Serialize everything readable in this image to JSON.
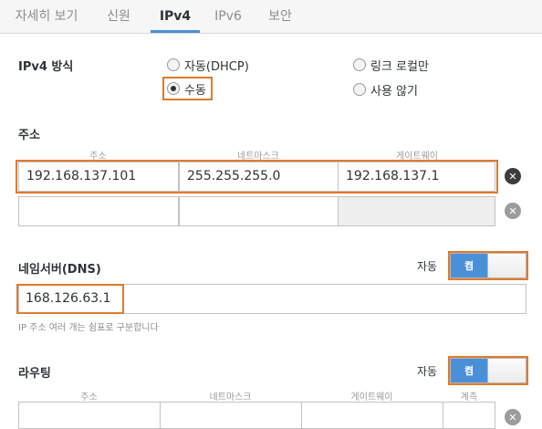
{
  "tabs": [
    {
      "label": "자세히 보기",
      "active": false
    },
    {
      "label": "신원",
      "active": false
    },
    {
      "label": "IPv4",
      "active": true
    },
    {
      "label": "IPv6",
      "active": false
    },
    {
      "label": "보안",
      "active": false
    }
  ],
  "ipv4_method": {
    "label": "IPv4 방식",
    "options": [
      {
        "label": "자동(DHCP)",
        "checked": false
      },
      {
        "label": "링크 로컬만",
        "checked": false
      },
      {
        "label": "수동",
        "checked": true
      },
      {
        "label": "사용 않기",
        "checked": false
      }
    ]
  },
  "addresses": {
    "label": "주소",
    "col_address": "주소",
    "col_netmask": "네트마스크",
    "col_gateway": "게이트웨이",
    "row1": {
      "address": "192.168.137.101",
      "netmask": "255.255.255.0",
      "gateway": "192.168.137.1"
    },
    "row2": {
      "address": "",
      "netmask": "",
      "gateway": ""
    }
  },
  "dns": {
    "label": "네임서버(DNS)",
    "auto_label": "자동",
    "toggle_label": "켬",
    "toggle_on": true,
    "value": "168.126.63.1",
    "hint": "IP 주소 여러 개는 쉼표로 구분합니다"
  },
  "routing": {
    "label": "라우팅",
    "auto_label": "자동",
    "toggle_label": "켬",
    "toggle_on": true,
    "col_address": "주소",
    "col_netmask": "네트마스크",
    "col_gateway": "게이트웨이",
    "col_metric": "계측"
  },
  "colors": {
    "accent": "#4a90d9",
    "highlight": "#e07a2c"
  },
  "icons": {
    "delete": "close-icon"
  }
}
